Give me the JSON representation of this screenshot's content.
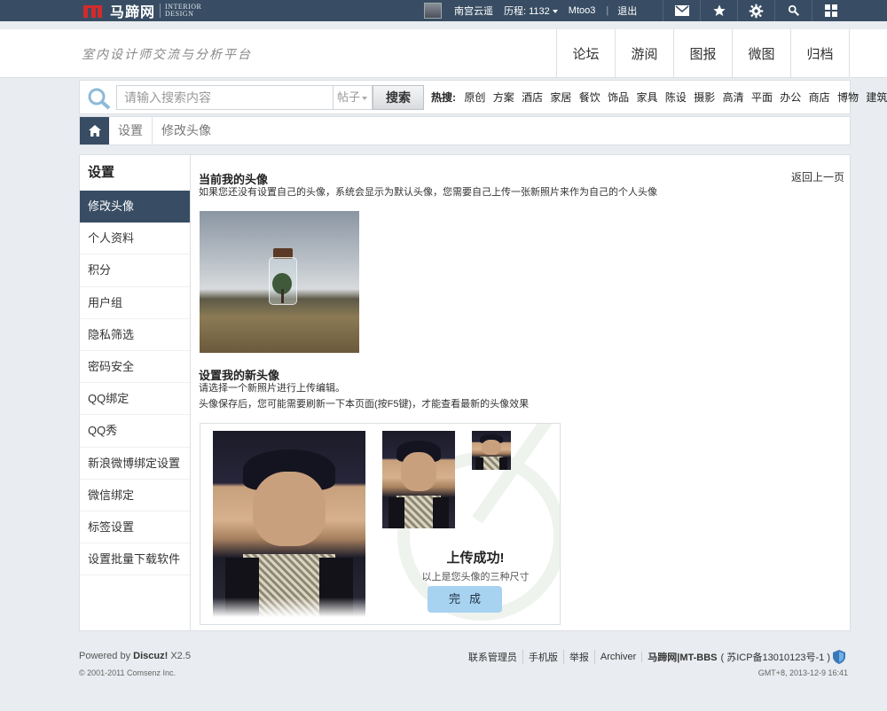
{
  "topbar": {
    "logo_cn": "马蹄网",
    "logo_en_1": "INTERIOR",
    "logo_en_2": "DESIGN",
    "username": "南宫云遥",
    "history": "历程: 1132",
    "mtoo": "Mtoo3",
    "logout": "退出",
    "icons": [
      "mail-icon",
      "star-icon",
      "gear-icon",
      "search-icon",
      "grid-icon"
    ]
  },
  "header": {
    "slogan": "室内设计师交流与分析平台",
    "nav": [
      "论坛",
      "游阅",
      "图报",
      "微图",
      "归档"
    ]
  },
  "search": {
    "placeholder": "请输入搜索内容",
    "type": "帖子",
    "button": "搜索",
    "hot_label": "热搜:",
    "hot": [
      "原创",
      "方案",
      "酒店",
      "家居",
      "餐饮",
      "饰品",
      "家具",
      "陈设",
      "摄影",
      "高清",
      "平面",
      "办公",
      "商店",
      "博物",
      "建筑"
    ]
  },
  "breadcrumb": [
    "设置",
    "修改头像"
  ],
  "sidebar": {
    "title": "设置",
    "items": [
      "修改头像",
      "个人资料",
      "积分",
      "用户组",
      "隐私筛选",
      "密码安全",
      "QQ绑定",
      "QQ秀",
      "新浪微博绑定设置",
      "微信绑定",
      "标签设置",
      "设置批量下载软件"
    ],
    "active_index": 0
  },
  "main": {
    "current_title": "当前我的头像",
    "current_desc": "如果您还没有设置自己的头像，系统会显示为默认头像，您需要自己上传一张新照片来作为自己的个人头像",
    "back": "返回上一页",
    "new_title": "设置我的新头像",
    "new_desc_1": "请选择一个新照片进行上传编辑。",
    "new_desc_2": "头像保存后，您可能需要刷新一下本页面(按F5键)，才能查看最新的头像效果",
    "success_title": "上传成功!",
    "success_sub": "以上是您头像的三种尺寸",
    "done": "完成"
  },
  "footer": {
    "powered_prefix": "Powered by ",
    "powered_brand": "Discuz!",
    "powered_ver": " X2.5",
    "copyright": "© 2001-2011 Comsenz Inc.",
    "links": [
      "联系管理员",
      "手机版",
      "举报",
      "Archiver"
    ],
    "site": "马蹄网|MT-BBS",
    "icp": "( 苏ICP备13010123号-1 )",
    "gmt": "GMT+8, 2013-12-9 16:41"
  },
  "colors": {
    "dark": "#384d63",
    "button_blue": "#a7d2f0"
  }
}
